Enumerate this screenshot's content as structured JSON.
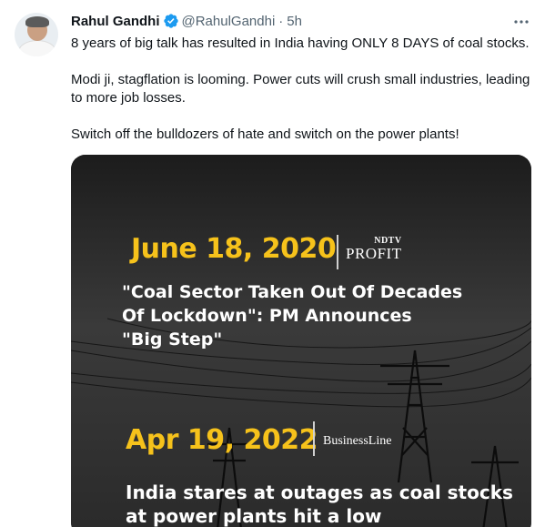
{
  "author": {
    "name": "Rahul Gandhi",
    "handle": "@RahulGandhi",
    "separator": "·",
    "time": "5h",
    "verified_icon": "verified-badge-icon",
    "verified_color": "#1d9bf0"
  },
  "tweet": {
    "paragraphs": [
      "8 years of big talk has resulted in India having ONLY 8 DAYS of coal stocks.",
      "Modi ji, stagflation is looming. Power cuts will crush small industries, leading to more job losses.",
      "Switch off the bulldozers of hate and switch on the power plants!"
    ]
  },
  "media": {
    "item1": {
      "date": "June 18, 2020",
      "source_top": "NDTV",
      "source_bottom": "PROFIT",
      "headline": "\"Coal Sector Taken Out Of Decades\n Of Lockdown\": PM Announces\n\"Big Step\""
    },
    "item2": {
      "date": "Apr 19, 2022",
      "source": "BusinessLine",
      "headline": "India stares at outages as coal stocks\nat power plants hit a low"
    },
    "accent_color": "#f6c21b"
  },
  "icons": {
    "more": "more-options-icon"
  }
}
